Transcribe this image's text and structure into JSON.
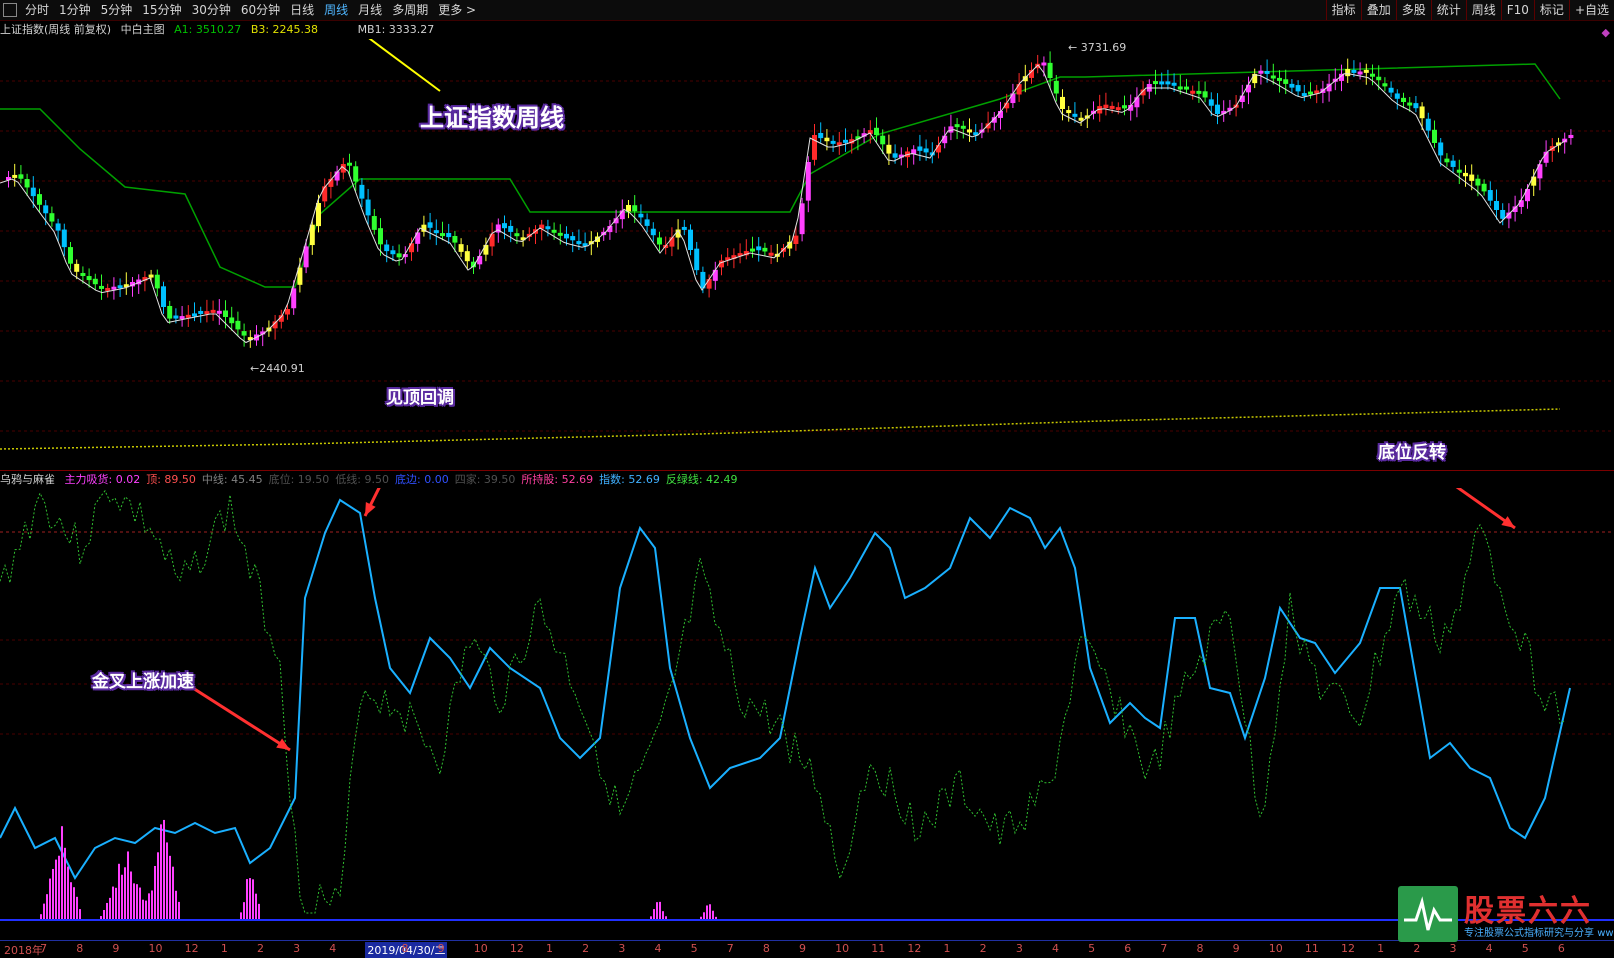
{
  "toolbar": {
    "periods": [
      "分时",
      "1分钟",
      "5分钟",
      "15分钟",
      "30分钟",
      "60分钟",
      "日线",
      "周线",
      "月线",
      "多周期",
      "更多 >"
    ],
    "active_period": "周线",
    "right_buttons": [
      "指标",
      "叠加",
      "多股",
      "统计",
      "周线",
      "F10",
      "标记",
      "+自选"
    ]
  },
  "info": {
    "title": "上证指数(周线 前复权)",
    "template": "中白主图",
    "a1": "A1: 3510.27",
    "b3": "B3: 2245.38",
    "mb1": "MB1: 3333.27"
  },
  "price_labels": {
    "high": "3731.69",
    "low": "2440.91"
  },
  "annotations": {
    "main_title": "上证指数周线",
    "top": "见顶回调",
    "bottom": "底位反转",
    "golden": "金叉上涨加速"
  },
  "indicator": {
    "name": "乌鸦与麻雀",
    "values": [
      {
        "label": "主力吸货: 0.02",
        "color": "#ff40ff"
      },
      {
        "label": "顶: 89.50",
        "color": "#ff5050"
      },
      {
        "label": "中线: 45.45",
        "color": "#808080"
      },
      {
        "label": "底位: 19.50",
        "color": "#505050"
      },
      {
        "label": "低线: 9.50",
        "color": "#505050"
      },
      {
        "label": "底边: 0.00",
        "color": "#3050ff"
      },
      {
        "label": "四家: 39.50",
        "color": "#505050"
      },
      {
        "label": "所持股: 52.69",
        "color": "#ff40a0"
      },
      {
        "label": "指数: 52.69",
        "color": "#40b0ff"
      },
      {
        "label": "反绿线: 42.49",
        "color": "#40e040"
      }
    ]
  },
  "x_axis": {
    "labels": [
      "2018年",
      "7",
      "8",
      "9",
      "10",
      "12",
      "1",
      "2",
      "3",
      "4",
      "2019/04/30/二",
      "8",
      "9",
      "10",
      "12",
      "1",
      "2",
      "3",
      "4",
      "5",
      "7",
      "8",
      "9",
      "10",
      "11",
      "12",
      "1",
      "2",
      "3",
      "4",
      "5",
      "6",
      "7",
      "8",
      "9",
      "10",
      "11",
      "12",
      "1",
      "2",
      "3",
      "4",
      "5",
      "6"
    ]
  },
  "logo": {
    "text": "股票六六",
    "sub": "专注股票公式指标研究与分享",
    "url": "www.GP66.CN"
  },
  "colors": {
    "up": "#ff2a2a",
    "down": "#00c0ff",
    "green_line": "#00a000",
    "index_line": "#1ab0ff",
    "dotted": "#30c030",
    "bars": "#ff40ff",
    "grid": "#4a0000"
  }
}
